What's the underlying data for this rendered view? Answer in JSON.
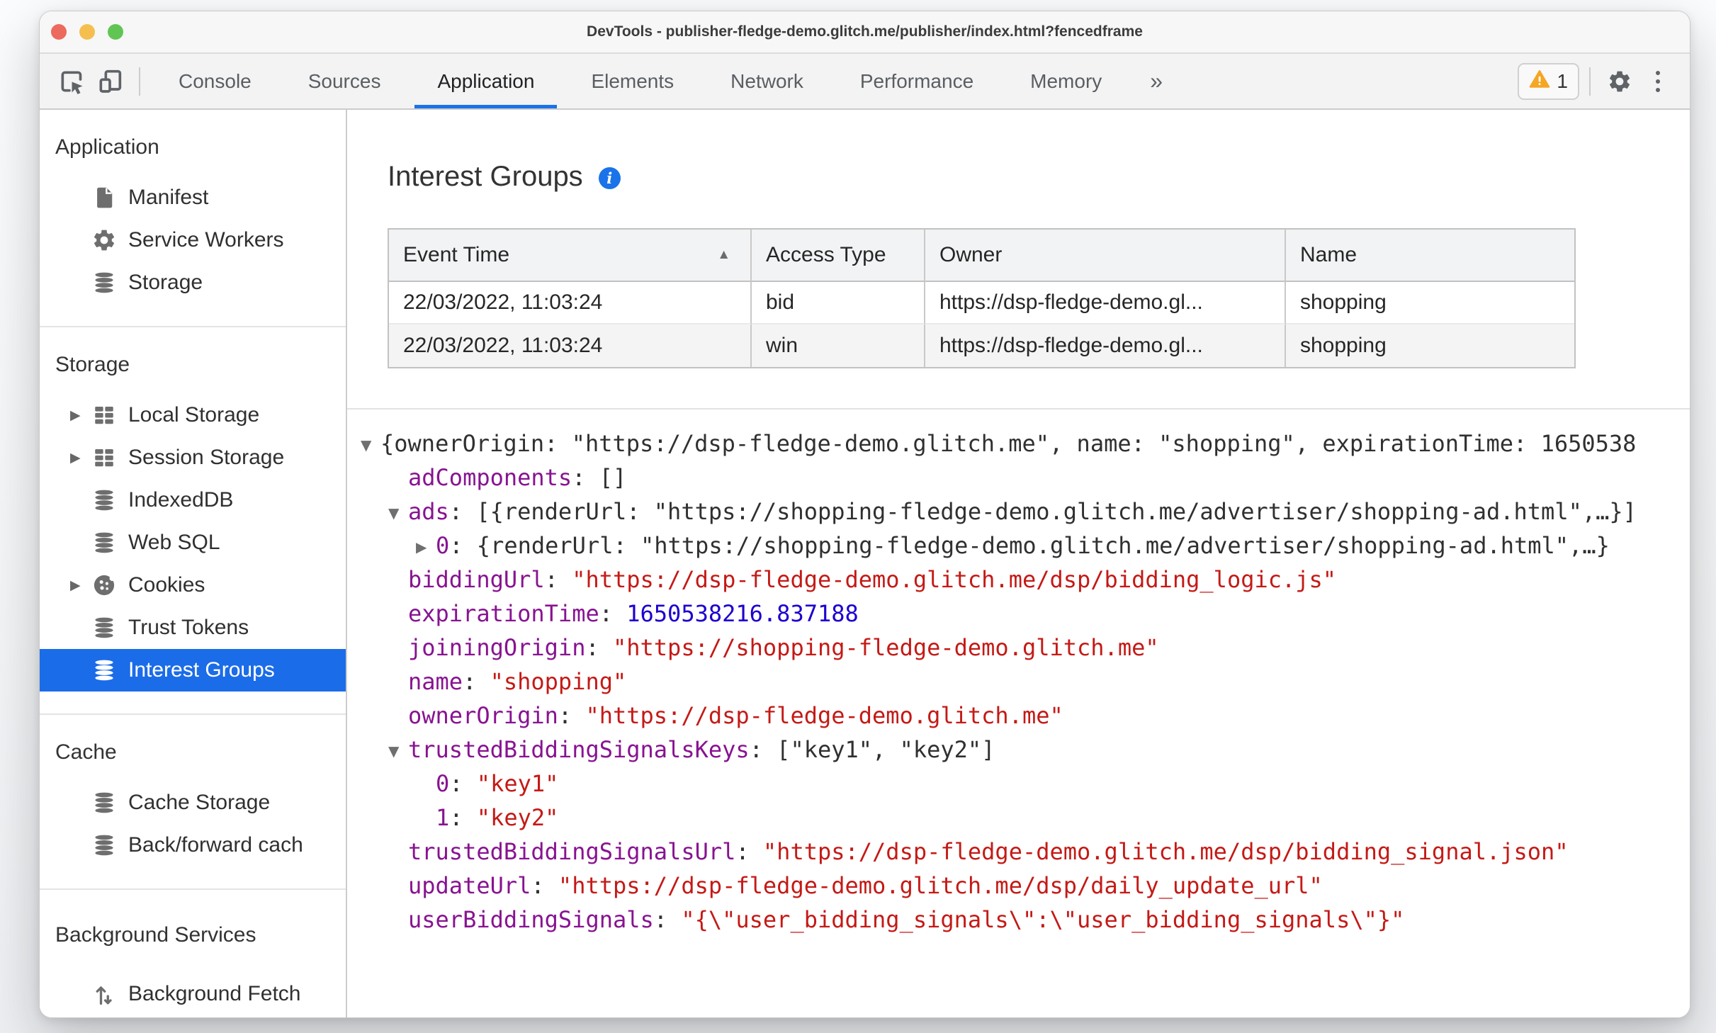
{
  "window": {
    "title": "DevTools - publisher-fledge-demo.glitch.me/publisher/index.html?fencedframe"
  },
  "colors": {
    "accent_blue": "#1a73e8",
    "selection_blue": "#1b6ce8",
    "key_purple": "#881391",
    "string_red": "#c41a16",
    "number_blue": "#1c00cf",
    "warning_yellow": "#f5a623",
    "traffic_red": "#ec6a5e",
    "traffic_yellow": "#f5bf4f",
    "traffic_green": "#61c554"
  },
  "icons": {
    "sort_asc": "▲",
    "collapse": "▼",
    "expand": "▶",
    "more_tabs": "»",
    "info_glyph": "i"
  },
  "toolbar": {
    "tabs": [
      "Console",
      "Sources",
      "Application",
      "Elements",
      "Network",
      "Performance",
      "Memory"
    ],
    "active_tab": "Application",
    "warning_count": "1"
  },
  "sidebar": {
    "sections": [
      {
        "title": "Application",
        "items": [
          {
            "label": "Manifest"
          },
          {
            "label": "Service Workers"
          },
          {
            "label": "Storage"
          }
        ]
      },
      {
        "title": "Storage",
        "items": [
          {
            "label": "Local Storage"
          },
          {
            "label": "Session Storage"
          },
          {
            "label": "IndexedDB"
          },
          {
            "label": "Web SQL"
          },
          {
            "label": "Cookies"
          },
          {
            "label": "Trust Tokens"
          },
          {
            "label": "Interest Groups"
          }
        ]
      },
      {
        "title": "Cache",
        "items": [
          {
            "label": "Cache Storage"
          },
          {
            "label": "Back/forward cach"
          }
        ]
      },
      {
        "title": "Background Services",
        "items": [
          {
            "label": "Background Fetch"
          }
        ]
      }
    ]
  },
  "main": {
    "title": "Interest Groups",
    "table": {
      "columns": [
        "Event Time",
        "Access Type",
        "Owner",
        "Name"
      ],
      "sort_column": "Event Time",
      "rows": [
        {
          "cells": [
            "22/03/2022, 11:03:24",
            "bid",
            "https://dsp-fledge-demo.gl...",
            "shopping"
          ]
        },
        {
          "cells": [
            "22/03/2022, 11:03:24",
            "win",
            "https://dsp-fledge-demo.gl...",
            "shopping"
          ]
        }
      ]
    },
    "tree": {
      "lines": [
        {
          "arrow": "▼",
          "parts": [
            {
              "t": "{ownerOrigin: \"https://dsp-fledge-demo.glitch.me\", name: \"shopping\", expirationTime: 1650538"
            }
          ]
        },
        {
          "parts": [
            {
              "t": "adComponents"
            },
            {
              "t": ": []"
            }
          ]
        },
        {
          "arrow": "▼",
          "parts": [
            {
              "t": "ads"
            },
            {
              "t": ": [{renderUrl: \"https://shopping-fledge-demo.glitch.me/advertiser/shopping-ad.html\",…}]"
            }
          ]
        },
        {
          "arrow": "▶",
          "parts": [
            {
              "t": "0"
            },
            {
              "t": ": {renderUrl: \"https://shopping-fledge-demo.glitch.me/advertiser/shopping-ad.html\",…}"
            }
          ]
        },
        {
          "parts": [
            {
              "t": "biddingUrl"
            },
            {
              "t": ": "
            },
            {
              "t": "\"https://dsp-fledge-demo.glitch.me/dsp/bidding_logic.js\""
            }
          ]
        },
        {
          "parts": [
            {
              "t": "expirationTime"
            },
            {
              "t": ": "
            },
            {
              "t": "1650538216.837188"
            }
          ]
        },
        {
          "parts": [
            {
              "t": "joiningOrigin"
            },
            {
              "t": ": "
            },
            {
              "t": "\"https://shopping-fledge-demo.glitch.me\""
            }
          ]
        },
        {
          "parts": [
            {
              "t": "name"
            },
            {
              "t": ": "
            },
            {
              "t": "\"shopping\""
            }
          ]
        },
        {
          "parts": [
            {
              "t": "ownerOrigin"
            },
            {
              "t": ": "
            },
            {
              "t": "\"https://dsp-fledge-demo.glitch.me\""
            }
          ]
        },
        {
          "arrow": "▼",
          "parts": [
            {
              "t": "trustedBiddingSignalsKeys"
            },
            {
              "t": ": [\"key1\", \"key2\"]"
            }
          ]
        },
        {
          "parts": [
            {
              "t": "0"
            },
            {
              "t": ": "
            },
            {
              "t": "\"key1\""
            }
          ]
        },
        {
          "parts": [
            {
              "t": "1"
            },
            {
              "t": ": "
            },
            {
              "t": "\"key2\""
            }
          ]
        },
        {
          "parts": [
            {
              "t": "trustedBiddingSignalsUrl"
            },
            {
              "t": ": "
            },
            {
              "t": "\"https://dsp-fledge-demo.glitch.me/dsp/bidding_signal.json\""
            }
          ]
        },
        {
          "parts": [
            {
              "t": "updateUrl"
            },
            {
              "t": ": "
            },
            {
              "t": "\"https://dsp-fledge-demo.glitch.me/dsp/daily_update_url\""
            }
          ]
        },
        {
          "parts": [
            {
              "t": "userBiddingSignals"
            },
            {
              "t": ": "
            },
            {
              "t": "\"{\\\"user_bidding_signals\\\":\\\"user_bidding_signals\\\"}\""
            }
          ]
        }
      ]
    }
  }
}
